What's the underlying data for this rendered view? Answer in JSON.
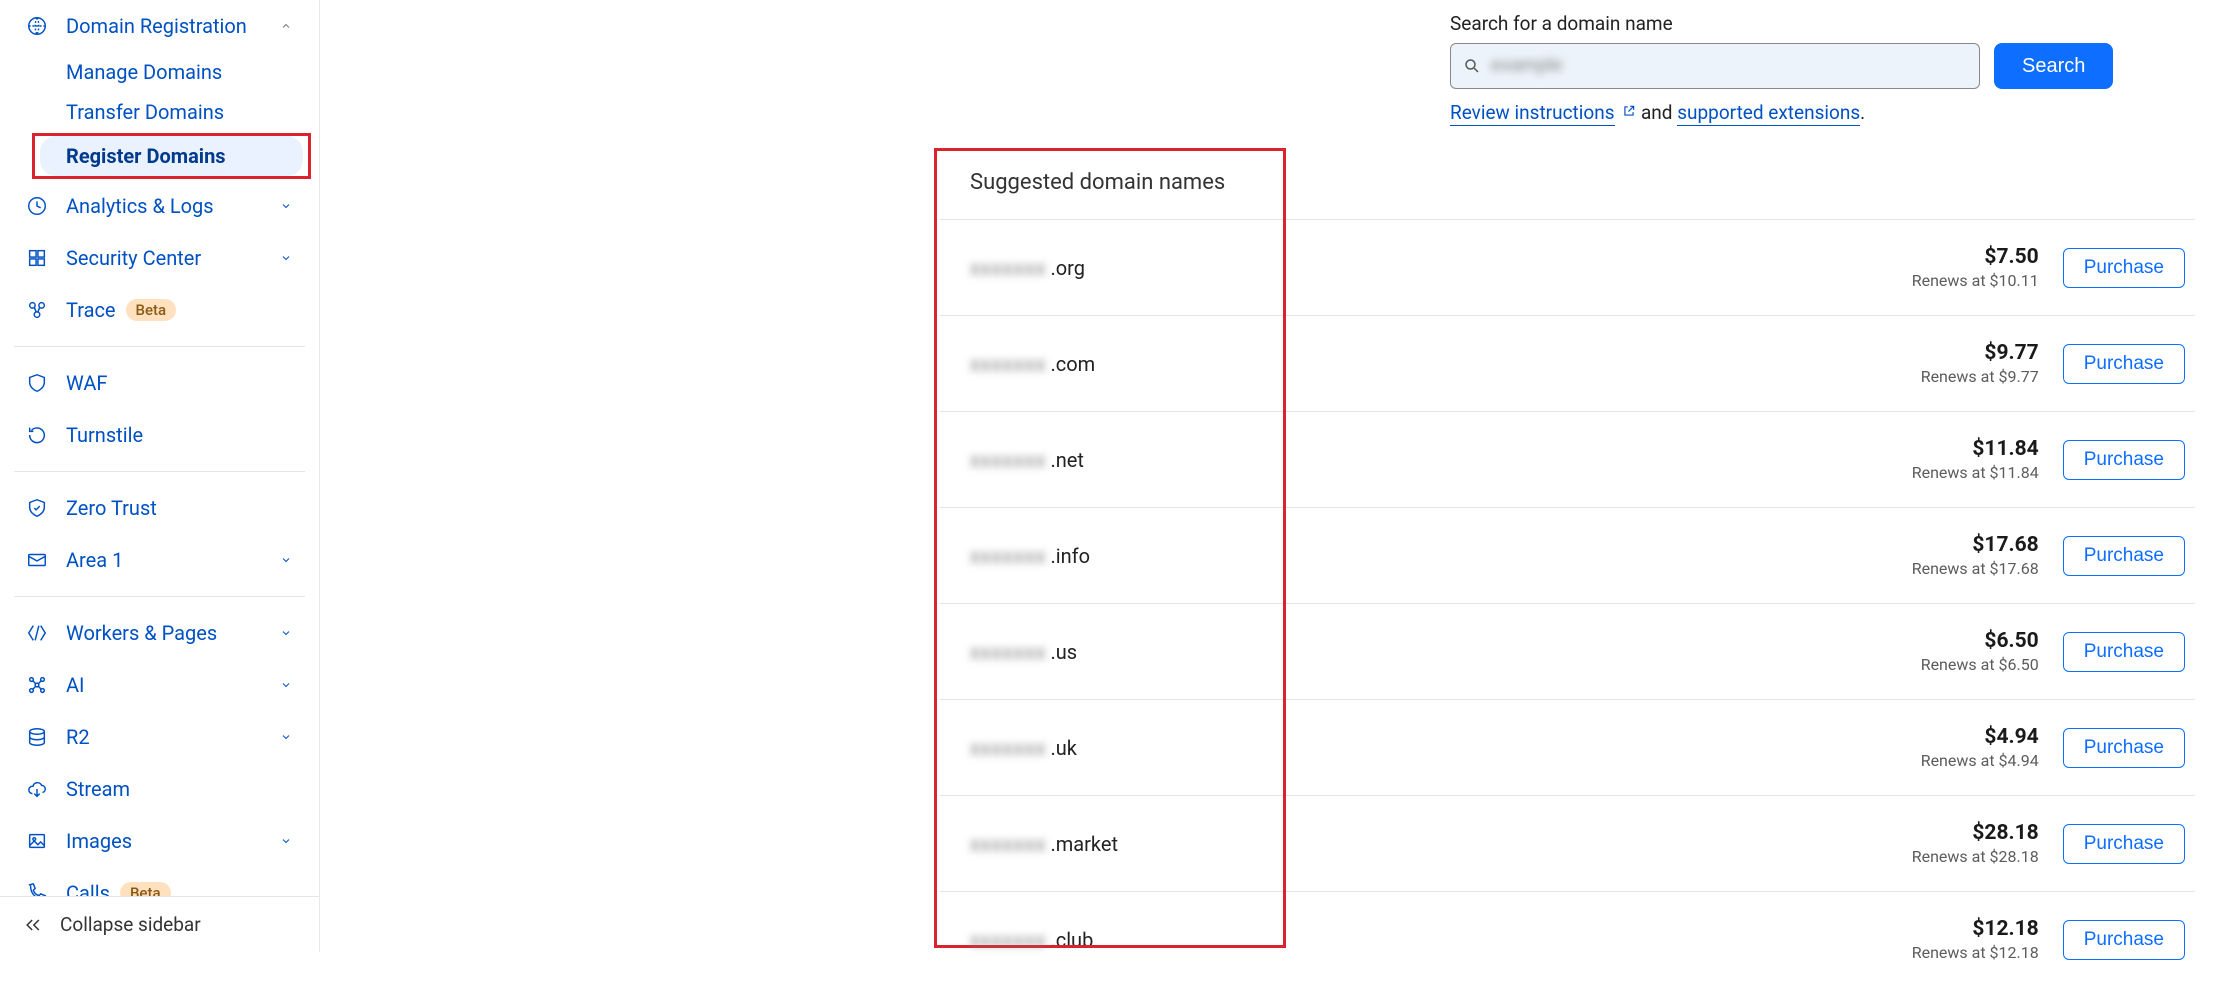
{
  "sidebar": {
    "domain_registration": {
      "label": "Domain Registration",
      "manage": "Manage Domains",
      "transfer": "Transfer Domains",
      "register": "Register Domains"
    },
    "analytics": "Analytics & Logs",
    "security": "Security Center",
    "trace": "Trace",
    "trace_badge": "Beta",
    "waf": "WAF",
    "turnstile": "Turnstile",
    "zero_trust": "Zero Trust",
    "area1": "Area 1",
    "workers": "Workers & Pages",
    "ai": "AI",
    "r2": "R2",
    "stream": "Stream",
    "images": "Images",
    "calls": "Calls",
    "calls_badge": "Beta",
    "collapse": "Collapse sidebar"
  },
  "search": {
    "label": "Search for a domain name",
    "value": "example",
    "button": "Search",
    "review": "Review instructions",
    "and": " and ",
    "supported": "supported extensions",
    "dot": "."
  },
  "suggested": {
    "title": "Suggested domain names",
    "renews_prefix": "Renews at ",
    "purchase": "Purchase",
    "rows": [
      {
        "blur": "xxxxxxx",
        "tld": ".org",
        "price": "$7.50",
        "renews": "$10.11"
      },
      {
        "blur": "xxxxxxx",
        "tld": ".com",
        "price": "$9.77",
        "renews": "$9.77"
      },
      {
        "blur": "xxxxxxx",
        "tld": ".net",
        "price": "$11.84",
        "renews": "$11.84"
      },
      {
        "blur": "xxxxxxx",
        "tld": ".info",
        "price": "$17.68",
        "renews": "$17.68"
      },
      {
        "blur": "xxxxxxx",
        "tld": ".us",
        "price": "$6.50",
        "renews": "$6.50"
      },
      {
        "blur": "xxxxxxx",
        "tld": ".uk",
        "price": "$4.94",
        "renews": "$4.94"
      },
      {
        "blur": "xxxxxxx",
        "tld": ".market",
        "price": "$28.18",
        "renews": "$28.18"
      },
      {
        "blur": "xxxxxxx",
        "tld": ".club",
        "price": "$12.18",
        "renews": "$12.18"
      }
    ]
  }
}
